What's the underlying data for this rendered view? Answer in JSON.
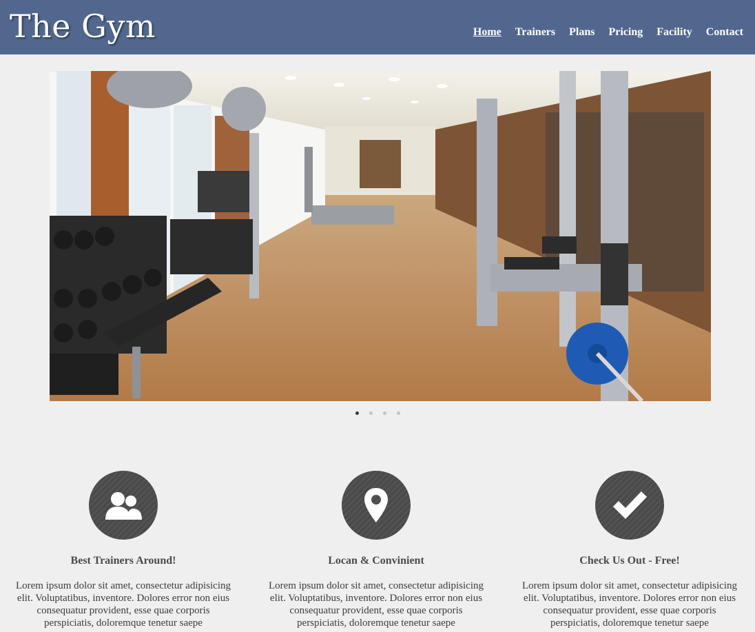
{
  "header": {
    "brand": "The Gym",
    "nav": [
      "Home",
      "Trainers",
      "Plans",
      "Pricing",
      "Facility",
      "Contact"
    ],
    "active_nav": "Home",
    "background_color": "#52678e"
  },
  "slider": {
    "image": "gym-interior-photo",
    "slide_count": 4,
    "active_slide": 1
  },
  "features": [
    {
      "icon": "users-icon",
      "title": "Best Trainers Around!",
      "text": "Lorem ipsum dolor sit amet, consectetur adipisicing elit. Voluptatibus, inventore. Dolores error non eius consequatur provident, esse quae corporis perspiciatis, doloremque tenetur saepe"
    },
    {
      "icon": "map-pin-icon",
      "title": "Locan & Convinient",
      "text": "Lorem ipsum dolor sit amet, consectetur adipisicing elit. Voluptatibus, inventore. Dolores error non eius consequatur provident, esse quae corporis perspiciatis, doloremque tenetur saepe"
    },
    {
      "icon": "checkmark-icon",
      "title": "Check Us Out - Free!",
      "text": "Lorem ipsum dolor sit amet, consectetur adipisicing elit. Voluptatibus, inventore. Dolores error non eius consequatur provident, esse quae corporis perspiciatis, doloremque tenetur saepe"
    }
  ]
}
